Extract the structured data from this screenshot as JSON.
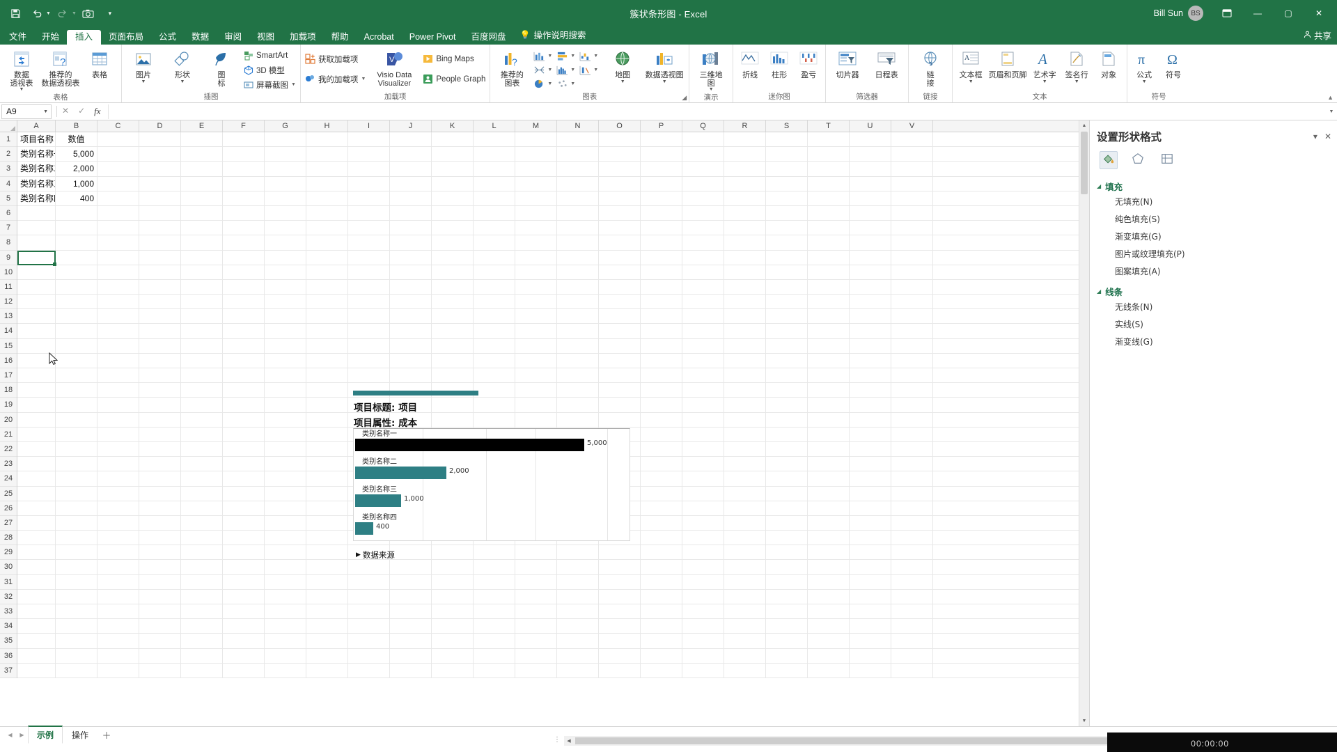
{
  "titlebar": {
    "document_title": "簇状条形图  -  Excel",
    "qat": [
      {
        "name": "save",
        "glyph": "💾"
      },
      {
        "name": "undo",
        "glyph": "↺"
      },
      {
        "name": "redo",
        "glyph": "↻"
      },
      {
        "name": "screenshot",
        "glyph": "📷"
      },
      {
        "name": "customize",
        "glyph": "▾"
      }
    ],
    "user_name": "Bill Sun",
    "user_initials": "BS",
    "window_buttons": [
      "⊡",
      "—",
      "▢",
      "✕"
    ]
  },
  "tabs": [
    {
      "label": "文件",
      "active": false
    },
    {
      "label": "开始",
      "active": false
    },
    {
      "label": "插入",
      "active": true
    },
    {
      "label": "页面布局",
      "active": false
    },
    {
      "label": "公式",
      "active": false
    },
    {
      "label": "数据",
      "active": false
    },
    {
      "label": "审阅",
      "active": false
    },
    {
      "label": "视图",
      "active": false
    },
    {
      "label": "加载项",
      "active": false
    },
    {
      "label": "帮助",
      "active": false
    },
    {
      "label": "Acrobat",
      "active": false
    },
    {
      "label": "Power Pivot",
      "active": false
    },
    {
      "label": "百度网盘",
      "active": false
    }
  ],
  "tellme": "操作说明搜索",
  "share": "共享",
  "ribbon": {
    "groups": [
      {
        "name": "表格",
        "big_buttons": [
          {
            "label": "数据",
            "label2": "透视表",
            "icon": "pivot-table-icon",
            "dropdown": true
          },
          {
            "label": "推荐的",
            "label2": "数据透视表",
            "icon": "recommended-pivot-icon",
            "dropdown": false
          },
          {
            "label": "表格",
            "label2": "",
            "icon": "table-icon",
            "dropdown": false
          }
        ]
      },
      {
        "name": "插图",
        "big_buttons": [
          {
            "label": "图片",
            "label2": "",
            "icon": "picture-icon",
            "dropdown": true
          },
          {
            "label": "形状",
            "label2": "",
            "icon": "shapes-icon",
            "dropdown": true
          },
          {
            "label": "图",
            "label2": "标",
            "icon": "icons-icon",
            "dropdown": false
          }
        ],
        "small_buttons": [
          {
            "label": "SmartArt",
            "icon": "smartart-icon",
            "dropdown": false
          },
          {
            "label": "3D 模型",
            "icon": "3d-model-icon",
            "dropdown": false
          },
          {
            "label": "屏幕截图",
            "icon": "screenshot-icon",
            "dropdown": true
          }
        ]
      },
      {
        "name": "加载项",
        "small_buttons": [
          {
            "label": "获取加载项",
            "icon": "get-addins-icon",
            "dropdown": false
          },
          {
            "label": "我的加载项",
            "icon": "my-addins-icon",
            "dropdown": true
          }
        ],
        "big_buttons": [
          {
            "label": "Visio Data",
            "label2": "Visualizer",
            "icon": "visio-icon",
            "dropdown": false
          }
        ],
        "small_buttons2": [
          {
            "label": "Bing Maps",
            "icon": "bing-maps-icon",
            "dropdown": false
          },
          {
            "label": "People Graph",
            "icon": "people-graph-icon",
            "dropdown": false
          }
        ]
      },
      {
        "name": "图表",
        "big_buttons": [
          {
            "label": "推荐的",
            "label2": "图表",
            "icon": "recommended-charts-icon",
            "dropdown": false
          }
        ],
        "chart_icons": [
          {
            "name": "column-chart-icon"
          },
          {
            "name": "bar-chart-icon"
          },
          {
            "name": "waterfall-chart-icon"
          },
          {
            "name": "scatter-chart-icon"
          },
          {
            "name": "histogram-chart-icon"
          },
          {
            "name": "stock-chart-icon"
          },
          {
            "name": "pie-chart-icon"
          },
          {
            "name": "map-chart-icon"
          }
        ],
        "extra_big": [
          {
            "label": "地图",
            "label2": "",
            "icon": "maps-icon",
            "dropdown": true
          },
          {
            "label": "数据透视图",
            "label2": "",
            "icon": "pivot-chart-icon",
            "dropdown": true
          }
        ],
        "dialog_launcher": true
      },
      {
        "name": "演示",
        "big_buttons": [
          {
            "label": "三维地",
            "label2": "图",
            "icon": "3d-map-icon",
            "dropdown": true
          }
        ]
      },
      {
        "name": "迷你图",
        "big_buttons": [
          {
            "label": "折线",
            "label2": "",
            "icon": "sparkline-line-icon",
            "dropdown": false
          },
          {
            "label": "柱形",
            "label2": "",
            "icon": "sparkline-column-icon",
            "dropdown": false
          },
          {
            "label": "盈亏",
            "label2": "",
            "icon": "sparkline-winloss-icon",
            "dropdown": false
          }
        ]
      },
      {
        "name": "筛选器",
        "big_buttons": [
          {
            "label": "切片器",
            "label2": "",
            "icon": "slicer-icon",
            "dropdown": false
          },
          {
            "label": "日程表",
            "label2": "",
            "icon": "timeline-icon",
            "dropdown": false
          }
        ]
      },
      {
        "name": "链接",
        "big_buttons": [
          {
            "label": "链",
            "label2": "接",
            "icon": "link-icon",
            "dropdown": true
          }
        ]
      },
      {
        "name": "文本",
        "big_buttons": [
          {
            "label": "文本框",
            "label2": "",
            "icon": "text-box-icon",
            "dropdown": true
          },
          {
            "label": "页眉和页脚",
            "label2": "",
            "icon": "header-footer-icon",
            "dropdown": false
          },
          {
            "label": "艺术字",
            "label2": "",
            "icon": "wordart-icon",
            "dropdown": true
          },
          {
            "label": "签名行",
            "label2": "",
            "icon": "signature-line-icon",
            "dropdown": true
          },
          {
            "label": "对象",
            "label2": "",
            "icon": "object-icon",
            "dropdown": false
          }
        ]
      },
      {
        "name": "符号",
        "big_buttons": [
          {
            "label": "公式",
            "label2": "",
            "icon": "equation-icon",
            "dropdown": true
          },
          {
            "label": "符号",
            "label2": "",
            "icon": "symbol-icon",
            "dropdown": false
          }
        ]
      }
    ]
  },
  "formula_bar": {
    "name_box": "A9",
    "cancel": "✕",
    "confirm": "✓",
    "fx": "fx",
    "value": "",
    "placeholder": ""
  },
  "sheet": {
    "columns": [
      "A",
      "B",
      "C",
      "D",
      "E",
      "F",
      "G",
      "H",
      "I",
      "J",
      "K",
      "L",
      "M",
      "N",
      "O",
      "P",
      "Q",
      "R",
      "S",
      "T",
      "U",
      "V"
    ],
    "rows": [
      1,
      2,
      3,
      4,
      5,
      6,
      7,
      8,
      9,
      10,
      11,
      12,
      13,
      14,
      15,
      16,
      17,
      18,
      19,
      20,
      21,
      22,
      23,
      24,
      25,
      26,
      27,
      28,
      29,
      30,
      31,
      32,
      33,
      34,
      35,
      36,
      37
    ],
    "data": [
      {
        "row": 1,
        "A": "项目名称",
        "B": "数值",
        "a_align": "ctr",
        "b_align": "ctr"
      },
      {
        "row": 2,
        "A": "类别名称一",
        "B": "5,000",
        "a_align": "left",
        "b_align": "num"
      },
      {
        "row": 3,
        "A": "类别名称二",
        "B": "2,000",
        "a_align": "left",
        "b_align": "num"
      },
      {
        "row": 4,
        "A": "类别名称三",
        "B": "1,000",
        "a_align": "left",
        "b_align": "num"
      },
      {
        "row": 5,
        "A": "类别名称四",
        "B": "400",
        "a_align": "left",
        "b_align": "num"
      }
    ],
    "selected_cell": "A9"
  },
  "chart_data": {
    "type": "bar",
    "title": "项目标题: 项目",
    "subtitle": "项目属性: 成本",
    "categories": [
      "类别名称一",
      "类别名称二",
      "类别名称三",
      "类别名称四"
    ],
    "values": [
      5000,
      2000,
      1000,
      400
    ],
    "value_labels": [
      "5,000",
      "2,000",
      "1,000",
      "400"
    ],
    "bar_colors": [
      "#000000",
      "#2e7f84",
      "#2e7f84",
      "#2e7f84"
    ],
    "accent_color": "#2e7f84",
    "xlabel": "",
    "ylabel": "",
    "xlim": [
      0,
      5600
    ],
    "grid": true,
    "gridline_count": 4,
    "footer": "数据来源",
    "footer_marker": "▶"
  },
  "task_pane": {
    "title": "设置形状格式",
    "dropdown_glyph": "▾",
    "close_glyph": "✕",
    "tabs": [
      {
        "name": "fill-line-tab",
        "icon": "paint-bucket-icon",
        "active": true
      },
      {
        "name": "effects-tab",
        "icon": "pentagon-icon",
        "active": false
      },
      {
        "name": "size-properties-tab",
        "icon": "layout-icon",
        "active": false
      }
    ],
    "sections": [
      {
        "label": "填充",
        "arrow": "◢",
        "options": [
          "无填充(N)",
          "纯色填充(S)",
          "渐变填充(G)",
          "图片或纹理填充(P)",
          "图案填充(A)"
        ]
      },
      {
        "label": "线条",
        "arrow": "◢",
        "options": [
          "无线条(N)",
          "实线(S)",
          "渐变线(G)"
        ]
      }
    ]
  },
  "status_bar": {
    "nav_first": "◀",
    "nav_last": "▶",
    "sheet_tabs": [
      {
        "label": "示例",
        "active": true
      },
      {
        "label": "操作",
        "active": false
      }
    ],
    "add_sheet": "＋",
    "dots": "⋮"
  },
  "recording": {
    "time": "00:00:00"
  }
}
